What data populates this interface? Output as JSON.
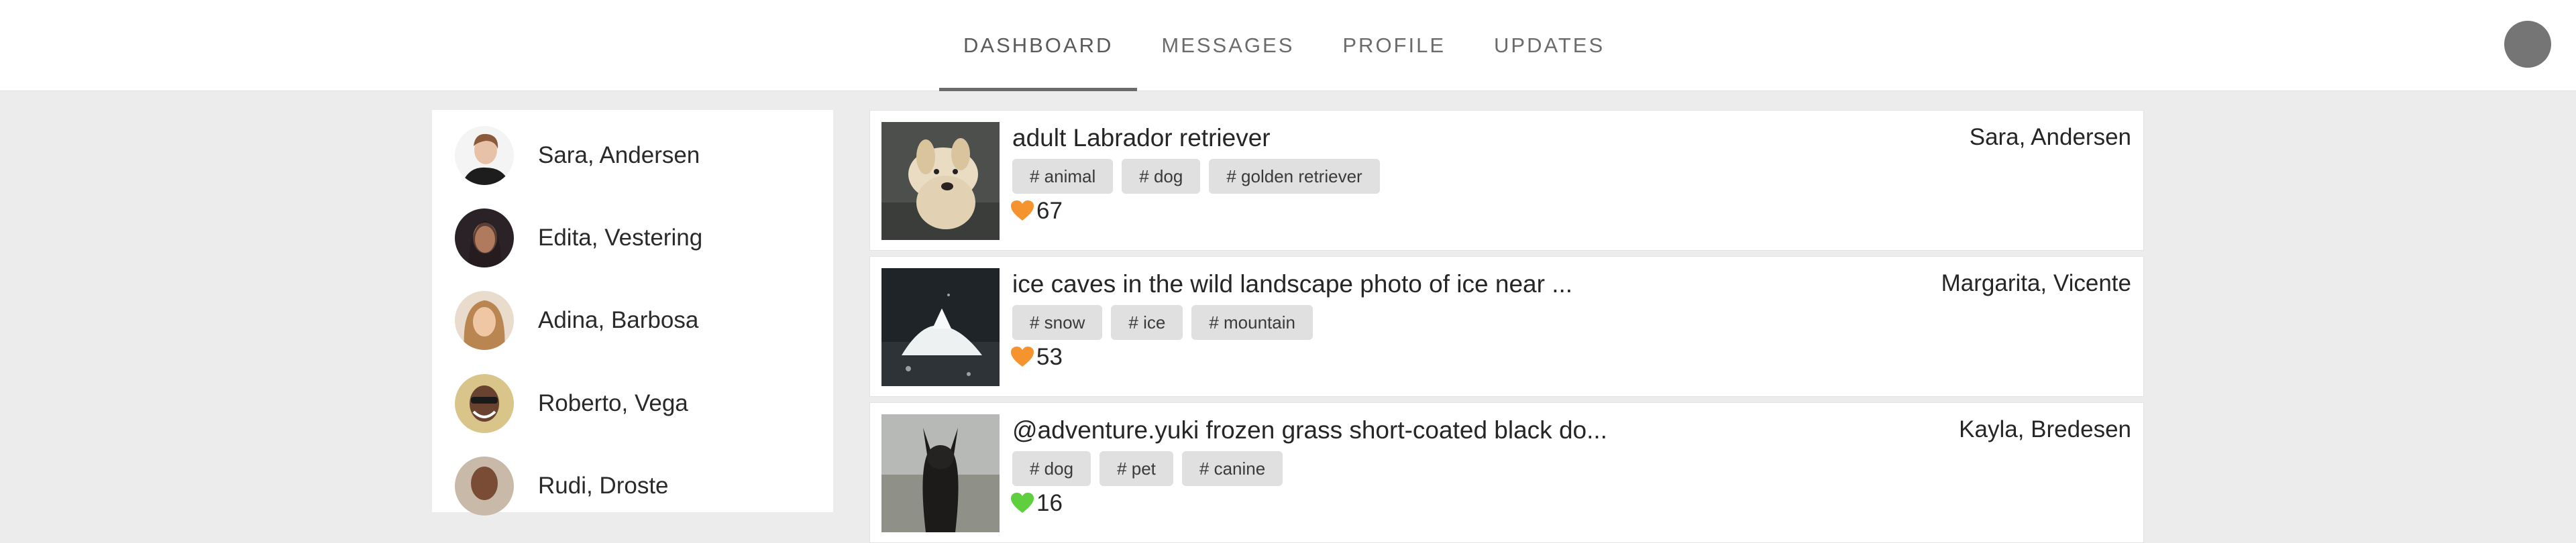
{
  "nav": {
    "tabs": [
      {
        "label": "DASHBOARD",
        "active": true
      },
      {
        "label": "MESSAGES",
        "active": false
      },
      {
        "label": "PROFILE",
        "active": false
      },
      {
        "label": "UPDATES",
        "active": false
      }
    ],
    "avatar_color": "#757575"
  },
  "sidebar": {
    "users": [
      {
        "name": "Sara, Andersen"
      },
      {
        "name": "Edita, Vestering"
      },
      {
        "name": "Adina, Barbosa"
      },
      {
        "name": "Roberto, Vega"
      },
      {
        "name": "Rudi, Droste"
      }
    ]
  },
  "feed": {
    "posts": [
      {
        "title": "adult Labrador retriever",
        "author": "Sara, Andersen",
        "tags": [
          "# animal",
          "# dog",
          "# golden retriever"
        ],
        "likes": "67",
        "heart_color": "#f5942e"
      },
      {
        "title": "ice caves in the wild landscape photo of ice near ...",
        "author": "Margarita, Vicente",
        "tags": [
          "# snow",
          "# ice",
          "# mountain"
        ],
        "likes": "53",
        "heart_color": "#f5942e"
      },
      {
        "title": "@adventure.yuki frozen grass short-coated black do...",
        "author": "Kayla, Bredesen",
        "tags": [
          "# dog",
          "# pet",
          "# canine"
        ],
        "likes": "16",
        "heart_color": "#5fce3f"
      }
    ]
  }
}
